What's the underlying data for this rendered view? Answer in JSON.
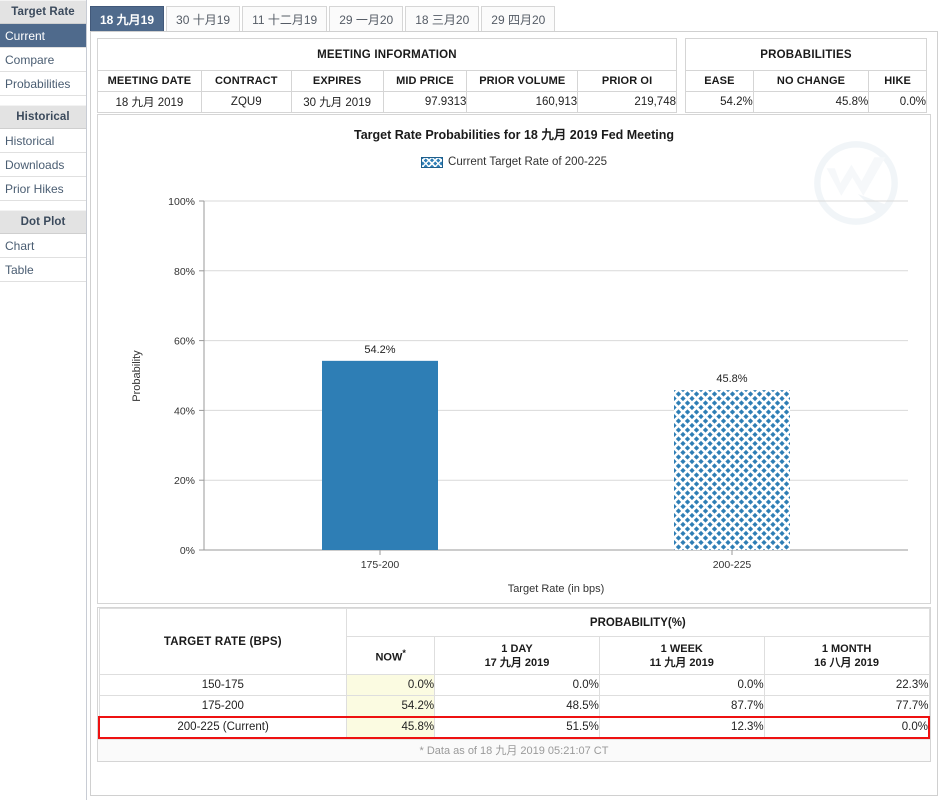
{
  "sidebar": {
    "groups": [
      {
        "title": "Target Rate",
        "items": [
          {
            "label": "Current",
            "active": true
          },
          {
            "label": "Compare",
            "active": false
          },
          {
            "label": "Probabilities",
            "active": false
          }
        ]
      },
      {
        "title": "Historical",
        "items": [
          {
            "label": "Historical",
            "active": false
          },
          {
            "label": "Downloads",
            "active": false
          },
          {
            "label": "Prior Hikes",
            "active": false
          }
        ]
      },
      {
        "title": "Dot Plot",
        "items": [
          {
            "label": "Chart",
            "active": false
          },
          {
            "label": "Table",
            "active": false
          }
        ]
      }
    ]
  },
  "tabs": [
    {
      "label": "18 九月19",
      "active": true
    },
    {
      "label": "30 十月19",
      "active": false
    },
    {
      "label": "11 十二月19",
      "active": false
    },
    {
      "label": "29 一月20",
      "active": false
    },
    {
      "label": "18 三月20",
      "active": false
    },
    {
      "label": "29 四月20",
      "active": false
    }
  ],
  "meeting_information": {
    "caption": "MEETING INFORMATION",
    "headers": [
      "MEETING DATE",
      "CONTRACT",
      "EXPIRES",
      "MID PRICE",
      "PRIOR VOLUME",
      "PRIOR OI"
    ],
    "values": [
      "18 九月 2019",
      "ZQU9",
      "30 九月 2019",
      "97.9313",
      "160,913",
      "219,748"
    ]
  },
  "probabilities_summary": {
    "caption": "PROBABILITIES",
    "headers": [
      "EASE",
      "NO CHANGE",
      "HIKE"
    ],
    "values": [
      "54.2%",
      "45.8%",
      "0.0%"
    ]
  },
  "chart_data": {
    "type": "bar",
    "title": "Target Rate Probabilities for 18 九月 2019  Fed Meeting",
    "legend": [
      {
        "label": "Current Target Rate of 200-225",
        "pattern": "cross-hatch",
        "color": "#2e7eb5"
      }
    ],
    "legend_position": "top-center",
    "categories": [
      "175-200",
      "200-225"
    ],
    "values": [
      54.2,
      45.8
    ],
    "bar_labels": [
      "54.2%",
      "45.8%"
    ],
    "bar_styles": [
      "solid",
      "cross-hatch"
    ],
    "xlabel": "Target Rate (in bps)",
    "ylabel": "Probability",
    "ylim": [
      0,
      100
    ],
    "ytick_labels": [
      "0%",
      "20%",
      "40%",
      "60%",
      "80%",
      "100%"
    ],
    "ytick_values": [
      0,
      20,
      40,
      60,
      80,
      100
    ],
    "grid": true,
    "bar_color": "#2e7eb5"
  },
  "probability_table": {
    "target_rate_header": "TARGET RATE (BPS)",
    "probability_header": "PROBABILITY(%)",
    "columns": [
      {
        "line1": "NOW",
        "line2": "",
        "star": "*"
      },
      {
        "line1": "1 DAY",
        "line2": "17 九月 2019",
        "star": ""
      },
      {
        "line1": "1 WEEK",
        "line2": "11 九月 2019",
        "star": ""
      },
      {
        "line1": "1 MONTH",
        "line2": "16 八月 2019",
        "star": ""
      }
    ],
    "rows": [
      {
        "label": "150-175",
        "now": "0.0%",
        "day": "0.0%",
        "week": "0.0%",
        "month": "22.3%",
        "current": false
      },
      {
        "label": "175-200",
        "now": "54.2%",
        "day": "48.5%",
        "week": "87.7%",
        "month": "77.7%",
        "current": false
      },
      {
        "label": "200-225 (Current)",
        "now": "45.8%",
        "day": "51.5%",
        "week": "12.3%",
        "month": "0.0%",
        "current": true
      }
    ],
    "footnote": "* Data as of 18 九月 2019 05:21:07 CT"
  },
  "colors": {
    "accent": "#4f6a8c",
    "bar": "#2e7eb5",
    "highlight_row_border": "#ee1111",
    "now_column_bg": "#fbfbe1"
  }
}
